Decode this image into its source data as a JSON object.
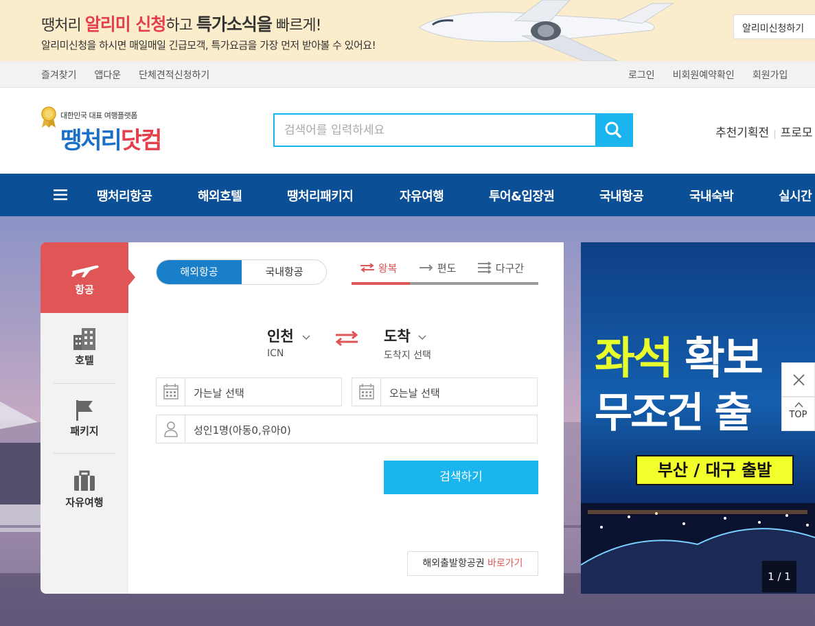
{
  "promo": {
    "line1_pre": "땡처리 ",
    "line1_red": "알리미 신청",
    "line1_mid": "하고 ",
    "line1_bold": "특가소식을",
    "line1_post": " 빠르게!",
    "line2": "알리미신청을 하시면 매일매일 긴급모객, 특가요금을 가장 먼저 받아볼 수 있어요!",
    "button": "알리미신청하기"
  },
  "util": {
    "left": [
      "즐겨찾기",
      "앱다운",
      "단체견적신청하기"
    ],
    "right": [
      "로그인",
      "비회원예약확인",
      "회원가입"
    ]
  },
  "header": {
    "logo_sub": "대한민국 대표 여행플랫폼",
    "logo_main_a": "땡처리",
    "logo_main_b": "닷컴",
    "search_placeholder": "검색어를 입력하세요",
    "right_a": "추천기획전",
    "right_b": "프로모"
  },
  "nav": {
    "items": [
      "땡처리항공",
      "해외호텔",
      "땡처리패키지",
      "자유여행",
      "투어&입장권",
      "국내항공",
      "국내숙박",
      "실시간"
    ]
  },
  "categories": [
    {
      "label": "항공",
      "icon": "plane-icon"
    },
    {
      "label": "호텔",
      "icon": "building-icon"
    },
    {
      "label": "패키지",
      "icon": "flag-icon"
    },
    {
      "label": "자유여행",
      "icon": "suitcase-icon"
    }
  ],
  "panel": {
    "seg_a": "해외항공",
    "seg_b": "국내항공",
    "trip": [
      "왕복",
      "편도",
      "다구간"
    ],
    "depart_city": "인천",
    "depart_code": "ICN",
    "arrive_city": "도착",
    "arrive_sub": "도착지 선택",
    "depart_date": "가는날 선택",
    "return_date": "오는날 선택",
    "passengers": "성인1명(아동0,유아0)",
    "search_button": "검색하기",
    "link_prefix": "해외출발항공권 ",
    "link_red": "바로가기"
  },
  "ad": {
    "t1_a": "좌석",
    "t1_b": " 확보",
    "t2": "무조건 출",
    "badge": "부산 / 대구 출발",
    "counter": "1 / 1"
  },
  "floating": {
    "top": "TOP"
  },
  "colors": {
    "accent_blue": "#1ab5ef",
    "nav_blue": "#0b4f97",
    "red": "#e05656"
  }
}
